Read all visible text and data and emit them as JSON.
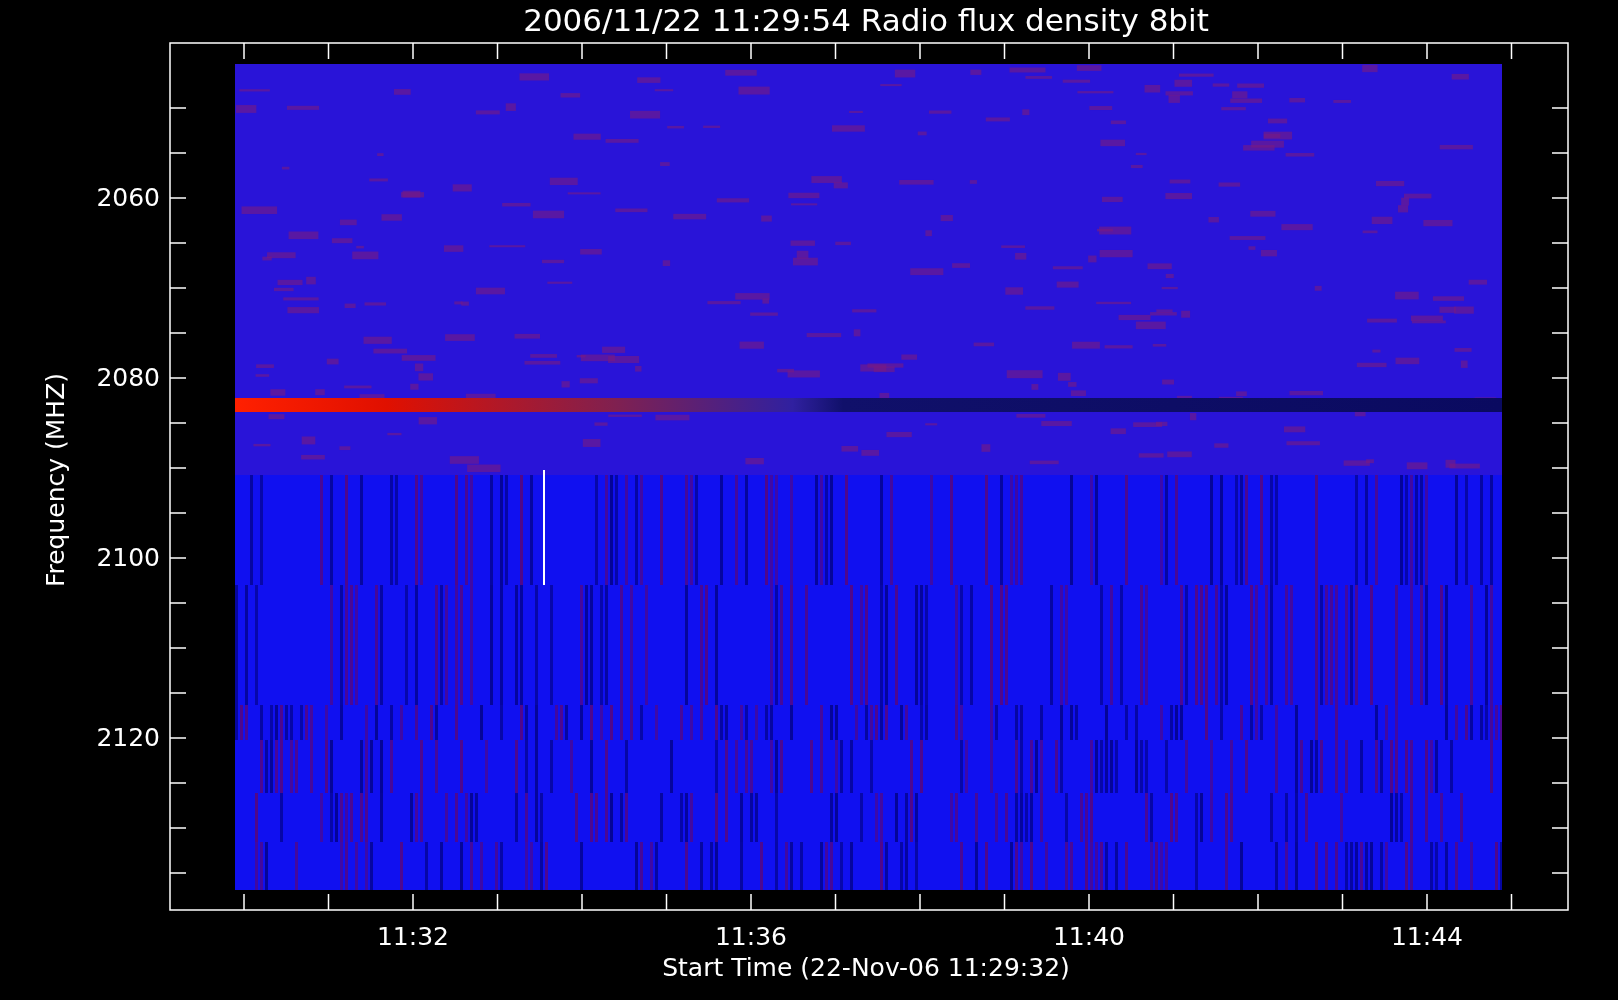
{
  "title": "2006/11/22 11:29:54 Radio flux density 8bit",
  "ylabel": "Frequency (MHZ)",
  "yticks": [
    "2060",
    "2080",
    "2100",
    "2120"
  ],
  "xticks": [
    "11:32",
    "11:36",
    "11:40",
    "11:44"
  ],
  "xlabel": "Start Time (22-Nov-06 11:29:32)"
}
